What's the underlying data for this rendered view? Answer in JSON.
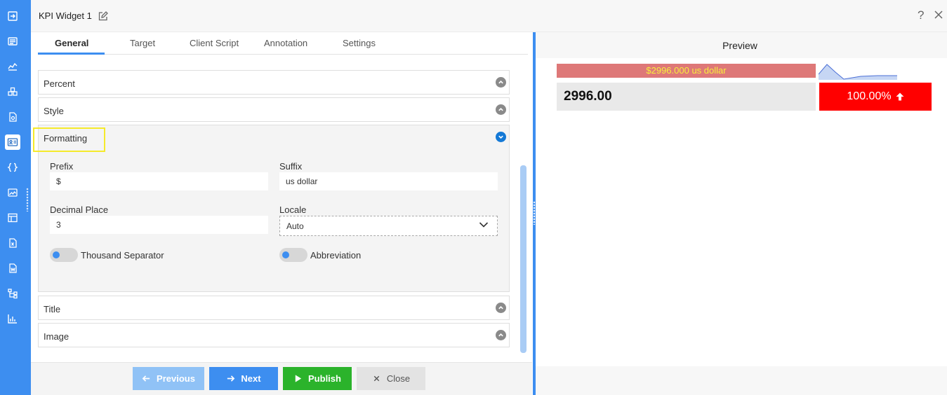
{
  "window": {
    "title": "KPI Widget 1",
    "help_symbol": "?"
  },
  "sidebar": {
    "items": [
      {
        "icon": "sign-in-icon"
      },
      {
        "icon": "list-icon"
      },
      {
        "icon": "line-chart-icon"
      },
      {
        "icon": "cubes-icon"
      },
      {
        "icon": "file-settings-icon"
      },
      {
        "icon": "kpi-card-icon",
        "active": true
      },
      {
        "icon": "braces-icon"
      },
      {
        "icon": "image-chart-icon"
      },
      {
        "icon": "table-icon"
      },
      {
        "icon": "excel-icon"
      },
      {
        "icon": "word-icon"
      },
      {
        "icon": "hierarchy-icon"
      },
      {
        "icon": "bar-chart-icon"
      }
    ]
  },
  "tabs": {
    "general": "General",
    "target": "Target",
    "client_script": "Client Script",
    "annotation": "Annotation",
    "settings": "Settings",
    "active": "General"
  },
  "sections": {
    "percent": "Percent",
    "style": "Style",
    "formatting": "Formatting",
    "title": "Title",
    "image": "Image"
  },
  "formatting": {
    "prefix_label": "Prefix",
    "prefix_value": "$",
    "suffix_label": "Suffix",
    "suffix_value": "us dollar",
    "decimal_label": "Decimal Place",
    "decimal_value": "3",
    "locale_label": "Locale",
    "locale_value": "Auto",
    "thousand_separator_label": "Thousand Separator",
    "thousand_separator_on": false,
    "abbreviation_label": "Abbreviation",
    "abbreviation_on": false
  },
  "footer": {
    "previous": "Previous",
    "next": "Next",
    "publish": "Publish",
    "close": "Close"
  },
  "preview": {
    "heading": "Preview",
    "target_text": "$2996.000 us dollar",
    "value": "2996.00",
    "change": "100.00%",
    "change_direction": "up",
    "colors": {
      "target_bar": "#de7878",
      "target_text": "#f8ef3c",
      "change_bg": "#ff0000",
      "accent": "#3d8ef0",
      "publish": "#2bb32b"
    }
  }
}
